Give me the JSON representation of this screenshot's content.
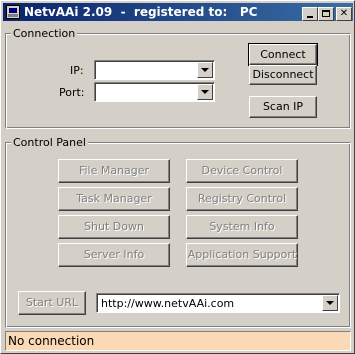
{
  "window": {
    "title": "NetvAAi 2.09  -  registered to:   PC"
  },
  "connection": {
    "group_label": "Connection",
    "ip_label": "IP:",
    "ip_value": "",
    "port_label": "Port:",
    "port_value": "",
    "connect_label": "Connect",
    "disconnect_label": "Disconnect",
    "scan_label": "Scan IP"
  },
  "control_panel": {
    "group_label": "Control Panel",
    "buttons": [
      "File Manager",
      "Device Control",
      "Task Manager",
      "Registry Control",
      "Shut Down",
      "System Info",
      "Server Info",
      "Application Support"
    ]
  },
  "url_bar": {
    "start_label": "Start URL",
    "url": "http://www.netvAAi.com"
  },
  "status": {
    "text": "No connection",
    "color": "#fcd9b6"
  }
}
